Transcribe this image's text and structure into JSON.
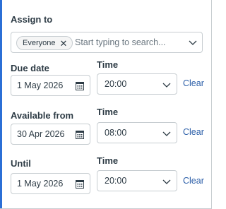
{
  "assign": {
    "label": "Assign to",
    "pill_label": "Everyone",
    "placeholder": "Start typing to search..."
  },
  "due": {
    "label": "Due date",
    "date_value": "1 May 2026",
    "time_label": "Time",
    "time_value": "20:00",
    "clear_label": "Clear"
  },
  "available_from": {
    "label": "Available from",
    "date_value": "30 Apr 2026",
    "time_label": "Time",
    "time_value": "08:00",
    "clear_label": "Clear"
  },
  "until": {
    "label": "Until",
    "date_value": "1 May 2026",
    "time_label": "Time",
    "time_value": "20:00",
    "clear_label": "Clear"
  },
  "colors": {
    "accent": "#2b6fd6",
    "text": "#2d3b45",
    "link": "#2b5ea8",
    "border": "#c7cdd1"
  },
  "icons": {
    "remove": "close-icon",
    "dropdown": "chevron-down-icon",
    "calendar": "calendar-icon"
  }
}
